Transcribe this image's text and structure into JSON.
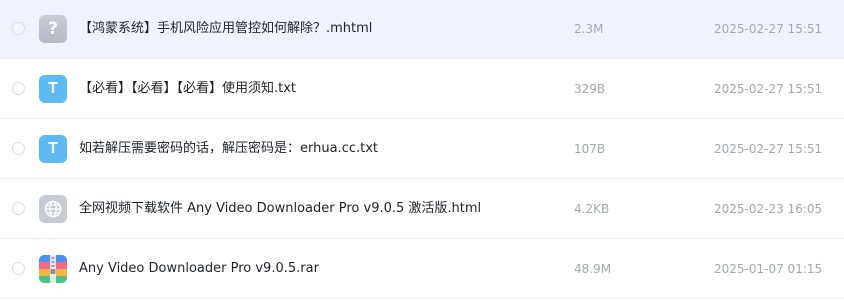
{
  "files": [
    {
      "name": "【鸿蒙系统】手机风险应用管控如何解除？.mhtml",
      "size": "2.3M",
      "modified": "2025-02-27 15:51",
      "icon": "unknown-file-icon",
      "icon_glyph": "?",
      "selected": true
    },
    {
      "name": "【必看】【必看】【必看】使用须知.txt",
      "size": "329B",
      "modified": "2025-02-27 15:51",
      "icon": "text-file-icon",
      "icon_glyph": "T",
      "selected": false
    },
    {
      "name": "如若解压需要密码的话，解压密码是：erhua.cc.txt",
      "size": "107B",
      "modified": "2025-02-27 15:51",
      "icon": "text-file-icon",
      "icon_glyph": "T",
      "selected": false
    },
    {
      "name": "全网视频下载软件 Any Video Downloader Pro v9.0.5 激活版.html",
      "size": "4.2KB",
      "modified": "2025-02-23 16:05",
      "icon": "globe-icon",
      "icon_glyph": "",
      "selected": false
    },
    {
      "name": "Any Video Downloader Pro v9.0.5.rar",
      "size": "48.9M",
      "modified": "2025-01-07 01:15",
      "icon": "archive-icon",
      "icon_glyph": "",
      "selected": false
    }
  ],
  "colors": {
    "selected_row_bg": "#eef3fe",
    "text_icon_bg": "#5fb9f2",
    "unknown_icon_bg": "#c0c5cf",
    "meta_text": "#a3a8b3",
    "name_text": "#1f2329"
  }
}
